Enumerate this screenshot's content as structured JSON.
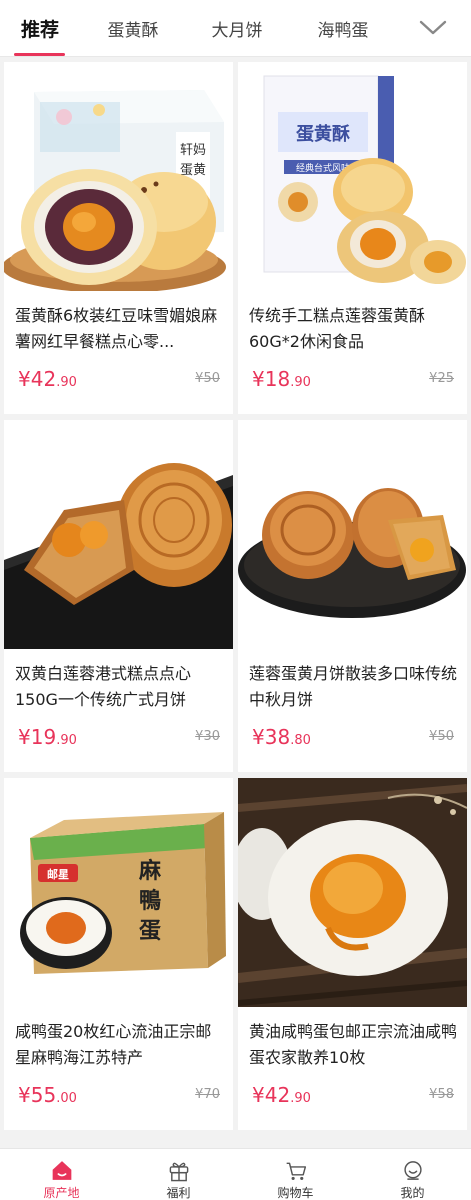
{
  "tabs": [
    {
      "label": "推荐",
      "active": true
    },
    {
      "label": "蛋黄酥",
      "active": false
    },
    {
      "label": "大月饼",
      "active": false
    },
    {
      "label": "海鸭蛋",
      "active": false
    }
  ],
  "more_icon": "chevron-down-icon",
  "products": [
    {
      "title": "蛋黄酥6枚装红豆味雪媚娘麻薯网红早餐糕点心零...",
      "currency": "¥",
      "price_int": "42",
      "price_dec": ".90",
      "orig": "¥50",
      "image": "egg-yolk-pastry-box-and-halved-pastry",
      "box_text": "轩妈蛋黄酥"
    },
    {
      "title": "传统手工糕点莲蓉蛋黄酥60G*2休闲食品",
      "currency": "¥",
      "price_int": "18",
      "price_dec": ".90",
      "orig": "¥25",
      "image": "blue-pastry-box-with-cut-pastries",
      "box_text": "蛋黄酥",
      "box_subtext": "经典台式风味"
    },
    {
      "title": "双黄白莲蓉港式糕点点心150G一个传统广式月饼",
      "currency": "¥",
      "price_int": "19",
      "price_dec": ".90",
      "orig": "¥30",
      "image": "double-yolk-mooncake-on-dark-plate"
    },
    {
      "title": "莲蓉蛋黄月饼散装多口味传统中秋月饼",
      "currency": "¥",
      "price_int": "38",
      "price_dec": ".80",
      "orig": "¥50",
      "image": "mooncakes-on-black-plate"
    },
    {
      "title": "咸鸭蛋20枚红心流油正宗邮星麻鸭海江苏特产",
      "currency": "¥",
      "price_int": "55",
      "price_dec": ".00",
      "orig": "¥70",
      "image": "salted-duck-egg-gift-box",
      "box_text": "麻鸭蛋",
      "brand_text": "邮星"
    },
    {
      "title": "黄油咸鸭蛋包邮正宗流油咸鸭蛋农家散养10枚",
      "currency": "¥",
      "price_int": "42",
      "price_dec": ".90",
      "orig": "¥58",
      "image": "halved-salted-egg-on-wood"
    }
  ],
  "bottom_nav": [
    {
      "label": "原产地",
      "icon": "home-icon",
      "active": true
    },
    {
      "label": "福利",
      "icon": "gift-icon",
      "active": false
    },
    {
      "label": "购物车",
      "icon": "cart-icon",
      "active": false
    },
    {
      "label": "我的",
      "icon": "user-icon",
      "active": false
    }
  ],
  "colors": {
    "accent": "#e8345a",
    "text": "#222222",
    "muted": "#999999",
    "background": "#f2f2f2"
  }
}
